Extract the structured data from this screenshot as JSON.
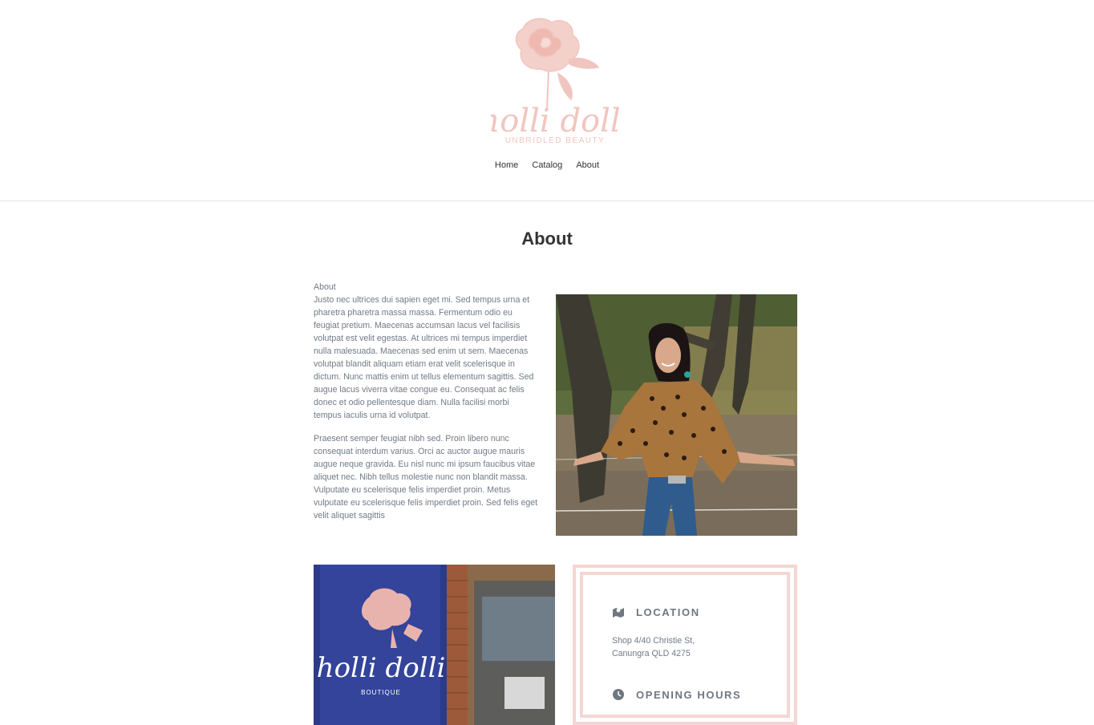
{
  "brand": {
    "logo_text": "holli dolli",
    "tagline": "UNBRIDLED BEAUTY"
  },
  "nav": {
    "items": [
      {
        "label": "Home"
      },
      {
        "label": "Catalog"
      },
      {
        "label": "About"
      }
    ]
  },
  "page": {
    "title": "About"
  },
  "about": {
    "heading": "About",
    "paragraph1": "Justo nec ultrices dui sapien eget mi. Sed tempus urna et pharetra pharetra massa massa. Fermentum odio eu feugiat pretium. Maecenas accumsan lacus vel facilisis volutpat est velit egestas. At ultrices mi tempus imperdiet nulla malesuada. Maecenas sed enim ut sem. Maecenas volutpat blandit aliquam etiam erat velit scelerisque in dictum. Nunc mattis enim ut tellus elementum sagittis. Sed augue lacus viverra vitae congue eu. Consequat ac felis donec et odio pellentesque diam. Nulla facilisi morbi tempus iaculis urna id volutpat.",
    "paragraph2": "Praesent semper feugiat nibh sed. Proin libero nunc consequat interdum varius. Orci ac auctor augue mauris augue neque gravida. Eu nisl nunc mi ipsum faucibus vitae aliquet nec. Nibh tellus molestie nunc non blandit massa. Vulputate eu scelerisque felis imperdiet proin. Metus vulputate eu scelerisque felis imperdiet proin. Sed felis eget velit aliquet sagittis"
  },
  "store_sign": {
    "logo_text": "holli dolli",
    "sub": "BOUTIQUE"
  },
  "info": {
    "location_heading": "LOCATION",
    "address_line1": "Shop 4/40 Christie St,",
    "address_line2": "Canungra QLD 4275",
    "hours_heading": "OPENING HOURS"
  },
  "colors": {
    "accent_pink": "#f1c5bf",
    "border_pink": "#f4d6d3",
    "text_grey": "#707a86",
    "heading_dark": "#333333"
  }
}
